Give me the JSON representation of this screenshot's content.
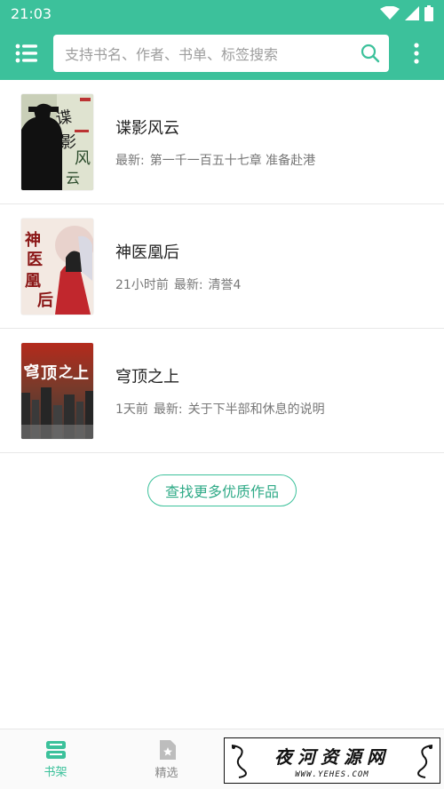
{
  "status_bar": {
    "time": "21:03"
  },
  "app_bar": {
    "search_placeholder": "支持书名、作者、书单、标签搜索",
    "menu_icon": "menu-icon",
    "search_icon": "search-icon",
    "more_icon": "more-vert-icon"
  },
  "books": [
    {
      "title": "谍影风云",
      "time_ago": "",
      "latest_label": "最新:",
      "latest_chapter": "第一千一百五十七章 准备赴港",
      "cover_text": "谍影风云"
    },
    {
      "title": "神医凰后",
      "time_ago": "21小时前",
      "latest_label": "最新:",
      "latest_chapter": "清誉4",
      "cover_text": "神医凰后"
    },
    {
      "title": "穹顶之上",
      "time_ago": "1天前",
      "latest_label": "最新:",
      "latest_chapter": "关于下半部和休息的说明",
      "cover_text": "穹顶之上"
    }
  ],
  "find_more_label": "查找更多优质作品",
  "bottom_nav": {
    "items": [
      {
        "label": "书架",
        "icon": "bookshelf-icon",
        "active": true
      },
      {
        "label": "精选",
        "icon": "featured-icon",
        "active": false
      },
      {
        "label": "",
        "icon": "ranking-icon",
        "active": false
      },
      {
        "label": "",
        "icon": "category-icon",
        "active": false
      }
    ]
  },
  "watermark": {
    "title": "夜河资源网",
    "url": "WWW.YEHES.COM"
  },
  "colors": {
    "primary": "#3cc19b",
    "text_primary": "#222222",
    "text_secondary": "#777777"
  }
}
